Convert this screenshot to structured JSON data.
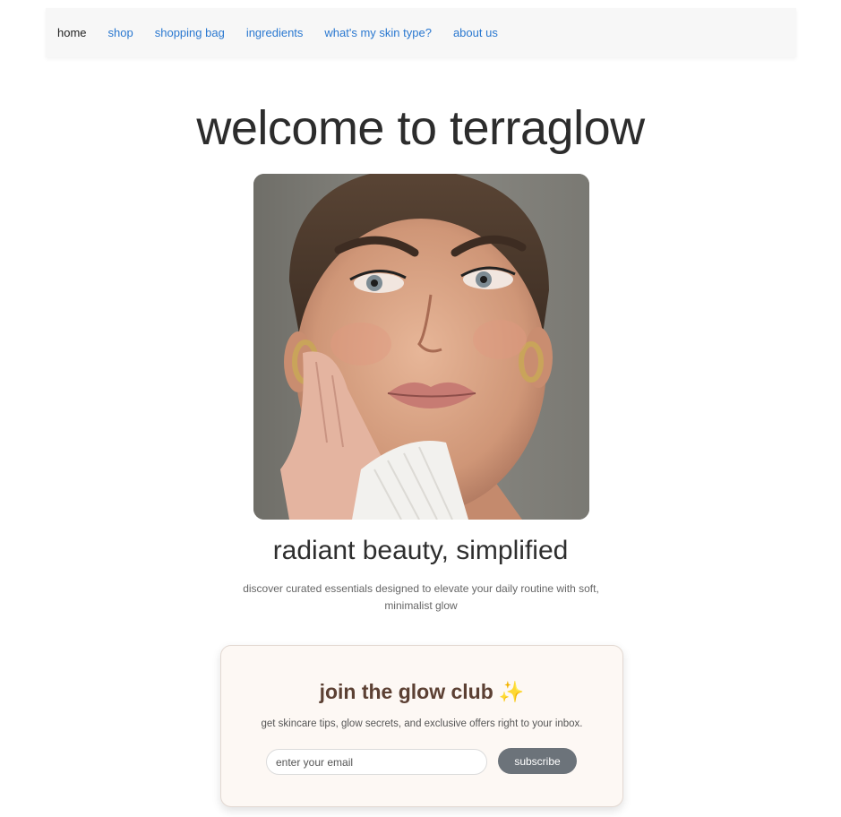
{
  "nav": {
    "items": [
      {
        "label": "home",
        "active": true
      },
      {
        "label": "shop",
        "active": false
      },
      {
        "label": "shopping bag",
        "active": false
      },
      {
        "label": "ingredients",
        "active": false
      },
      {
        "label": "what's my skin type?",
        "active": false
      },
      {
        "label": "about us",
        "active": false
      }
    ]
  },
  "hero": {
    "title": "welcome to terraglow",
    "image_icon": "portrait-photo",
    "tagline": "radiant beauty, simplified",
    "description": "discover curated essentials designed to elevate your daily routine with soft, minimalist glow"
  },
  "newsletter": {
    "title": "join the glow club",
    "emoji": "✨",
    "text": "get skincare tips, glow secrets, and exclusive offers right to your inbox.",
    "email_placeholder": "enter your email",
    "email_value": "",
    "button_label": "subscribe"
  },
  "colors": {
    "link": "#2a78d0",
    "accent_brown": "#5c4033",
    "button": "#6c737a",
    "card_bg": "#fdf8f4"
  }
}
